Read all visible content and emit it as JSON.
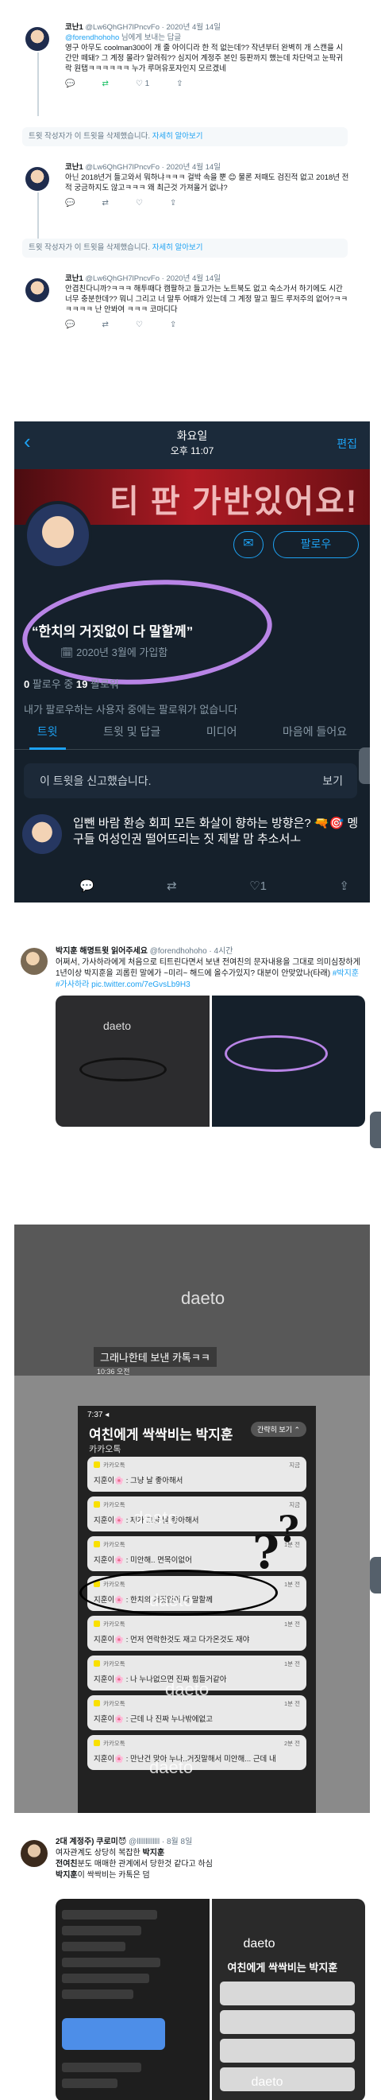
{
  "tweet1": {
    "name": "코난1",
    "handle": "@Lw6QhGH7lPncvFo",
    "date": "· 2020년 4월 14일",
    "reply_to_prefix": "@forendhohoho",
    "reply_to_suffix": " 님에게 보내는 답글",
    "text": "영구 아무도 coolman300이 개 줄 아이디라 한 적 없는데?? 작년부터 완벽히 개 스캔을 시간만 떼돼? 그 계정 몰라? 알려줘?? 심지어 계정주 본인 등판까지 했는데 차단먹고 눈팍귀락 원탭ㅋㅋㅋㅋㅋㅋ 누가 루머유포자인지 모르겠네",
    "actions": [
      "💬",
      "⇄",
      "♡ 1",
      "⇪"
    ]
  },
  "deleted1": {
    "text": "트윗 작성자가 이 트윗을 삭제했습니다. ",
    "more": "자세히 알아보기"
  },
  "tweet2": {
    "name": "코난1",
    "handle": "@Lw6QhGH7lPncvFo",
    "date": "· 2020년 4월 14일",
    "text": "아닌 2018년거 들고와서 뭐하냐ㅋㅋㅋ 걸박 속을 뿐 😊 물론 저때도 검진적 없고 2018년 전적 궁금하지도 않고ㅋㅋㅋ 왜 최근것 가져올거 없냐?",
    "actions": [
      "💬",
      "⇄",
      "♡",
      "⇪"
    ]
  },
  "deleted2": {
    "text": "트윗 작성자가 이 트윗을 삭제했습니다. ",
    "more": "자세히 알아보기"
  },
  "tweet3": {
    "name": "코난1",
    "handle": "@Lw6QhGH7lPncvFo",
    "date": "· 2020년 4월 14일",
    "text": "안겹친다니까?ㅋㅋㅋ 해투때다 캠팔하고 들고가는 노트북도 없고 숙소가서 하기에도 시간 너무 충분한데?? 뭐니 그리고 너 말투 어때가 있는데 그 계정 말고 필드 루저주의 없어?ㅋㅋㅋㅋㅋㅋ 난 안봐여 ㅋㅋㅋ 코마디다",
    "actions": [
      "💬",
      "⇄",
      "♡",
      "⇪"
    ]
  },
  "profile": {
    "back": "‹",
    "day": "화요일",
    "time": "오후 11:07",
    "edit": "편집",
    "banner_text": "티 판 가반있어요!",
    "mail_icon": "✉",
    "follow": "팔로우",
    "bio": "“한치의 거짓없이 다 말할께”",
    "joined_icon": "🗓",
    "joined": "2020년 3월에 가입함",
    "following_count": "0",
    "following_label": " 팔로우 중  ",
    "followers_count": "19",
    "followers_label": " 팔로워",
    "no_followers": "내가 팔로우하는 사용자 중에는 팔로워가 없습니다",
    "tabs": [
      "트윗",
      "트윗 및 답글",
      "미디어",
      "마음에 들어요"
    ],
    "report": "이 트윗을 신고했습니다.",
    "report_see": "보기",
    "pinned_text": "입뺀 바람 환승 회피 모든 화살이 향하는 방향은? 🔫🎯 멩구들 여성인권 떨어뜨리는 짓 제발 맘 추소서ㅗ",
    "actions": [
      "💬",
      "⇄",
      "♡1",
      "⇪"
    ]
  },
  "tweet4": {
    "name": "박지훈 해명트윗 읽어주세요",
    "handle": "@forendhohoho",
    "date": "· 4시간",
    "text": "어쩌서, 가사하라에게 처음으로 티트린다면서 보낸 전여친의 문자내용을 그대로 의미심장하게 1년이상 박지훈을 괴롭힌 말에가 ~미리~ 해드에 올수가있지? 대분이 안맞았나(타래) ",
    "tags": "#박지훈 #가사하라",
    "link": " pic.twitter.com/7eGvsLb9H3"
  },
  "kakao": {
    "watermark": "daeto",
    "top_bubble": "그래나한테 보낸 카톡ㅋㅋ",
    "top_time": "10:36 오전",
    "status": "7:37 ◂",
    "title": "여친에게 싹싹비는 박지훈",
    "app": "카카오톡",
    "hide": "간략히 보기 ⌃",
    "notifs": [
      {
        "who": "카카오톡",
        "when": "지금",
        "msg": "지훈이🌸 : 그냥 날 좋아해서"
      },
      {
        "who": "카카오톡",
        "when": "지금",
        "msg": "지훈이🌸 : 제가 그냥 날 좋아해서"
      },
      {
        "who": "카카오톡",
        "when": "1분 전",
        "msg": "지훈이🌸 : 미안해.. 면목이없어"
      },
      {
        "who": "카카오톡",
        "when": "1분 전",
        "msg": "지훈이🌸 : 한치의 거짓없이 다 말할께"
      },
      {
        "who": "카카오톡",
        "when": "1분 전",
        "msg": "지훈이🌸 : 먼저 연락한것도 재고 다가온것도 재야"
      },
      {
        "who": "카카오톡",
        "when": "1분 전",
        "msg": "지훈이🌸 : 나 누나없으면 진짜 힘들거같아"
      },
      {
        "who": "카카오톡",
        "when": "1분 전",
        "msg": "지훈이🌸 : 근데 나 진짜 누나밖에없고"
      },
      {
        "who": "카카오톡",
        "when": "2분 전",
        "msg": "지훈이🌸 : 만난건 맞아 누나..거짓말해서 미안해... 근데 내"
      }
    ]
  },
  "tweet5": {
    "name": "2대 계정주) 쿠로미😈",
    "handle": "@lllllllllllll",
    "date": "· 8월 8일",
    "line1": "여자관계도 상당히 복잡한 ",
    "line1b": "박지훈",
    "line2": "전여친",
    "line2b": "분도 매매한 관계에서 당한것 같다고 하심",
    "line3": "박지훈",
    "line3b": "이 싹싹비는 카톡은 덤",
    "right_title": "여친에게 싹싹비는 박지훈",
    "watermark": "daeto"
  }
}
